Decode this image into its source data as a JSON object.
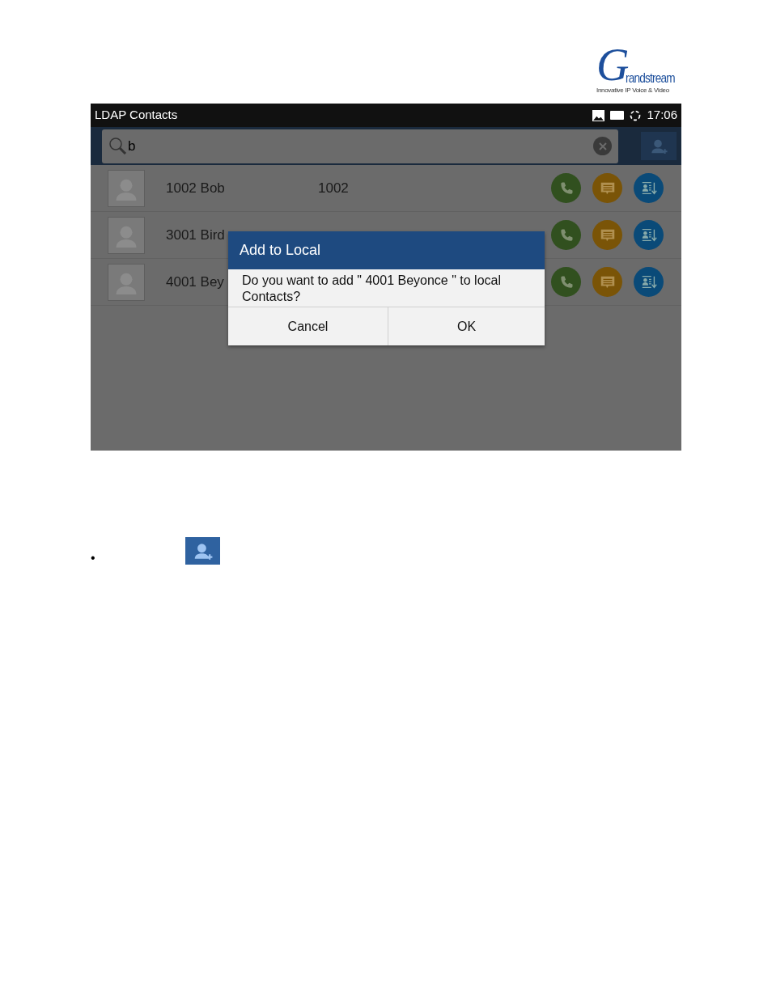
{
  "logo": {
    "initial": "G",
    "wordmark": "randstream",
    "tagline": "Innovative IP Voice & Video"
  },
  "status_bar": {
    "title": "LDAP Contacts",
    "time": "17:06"
  },
  "search": {
    "value": "b"
  },
  "contacts": [
    {
      "name": "1002 Bob",
      "number": "1002"
    },
    {
      "name": "3001 Bird"
    },
    {
      "name": "4001 Bey"
    }
  ],
  "dialog": {
    "title": "Add to Local",
    "message": "Do you want to add \" 4001 Beyonce \" to local Contacts?",
    "buttons": [
      "Cancel",
      "OK"
    ]
  },
  "bullet": {
    "mark": "•"
  }
}
